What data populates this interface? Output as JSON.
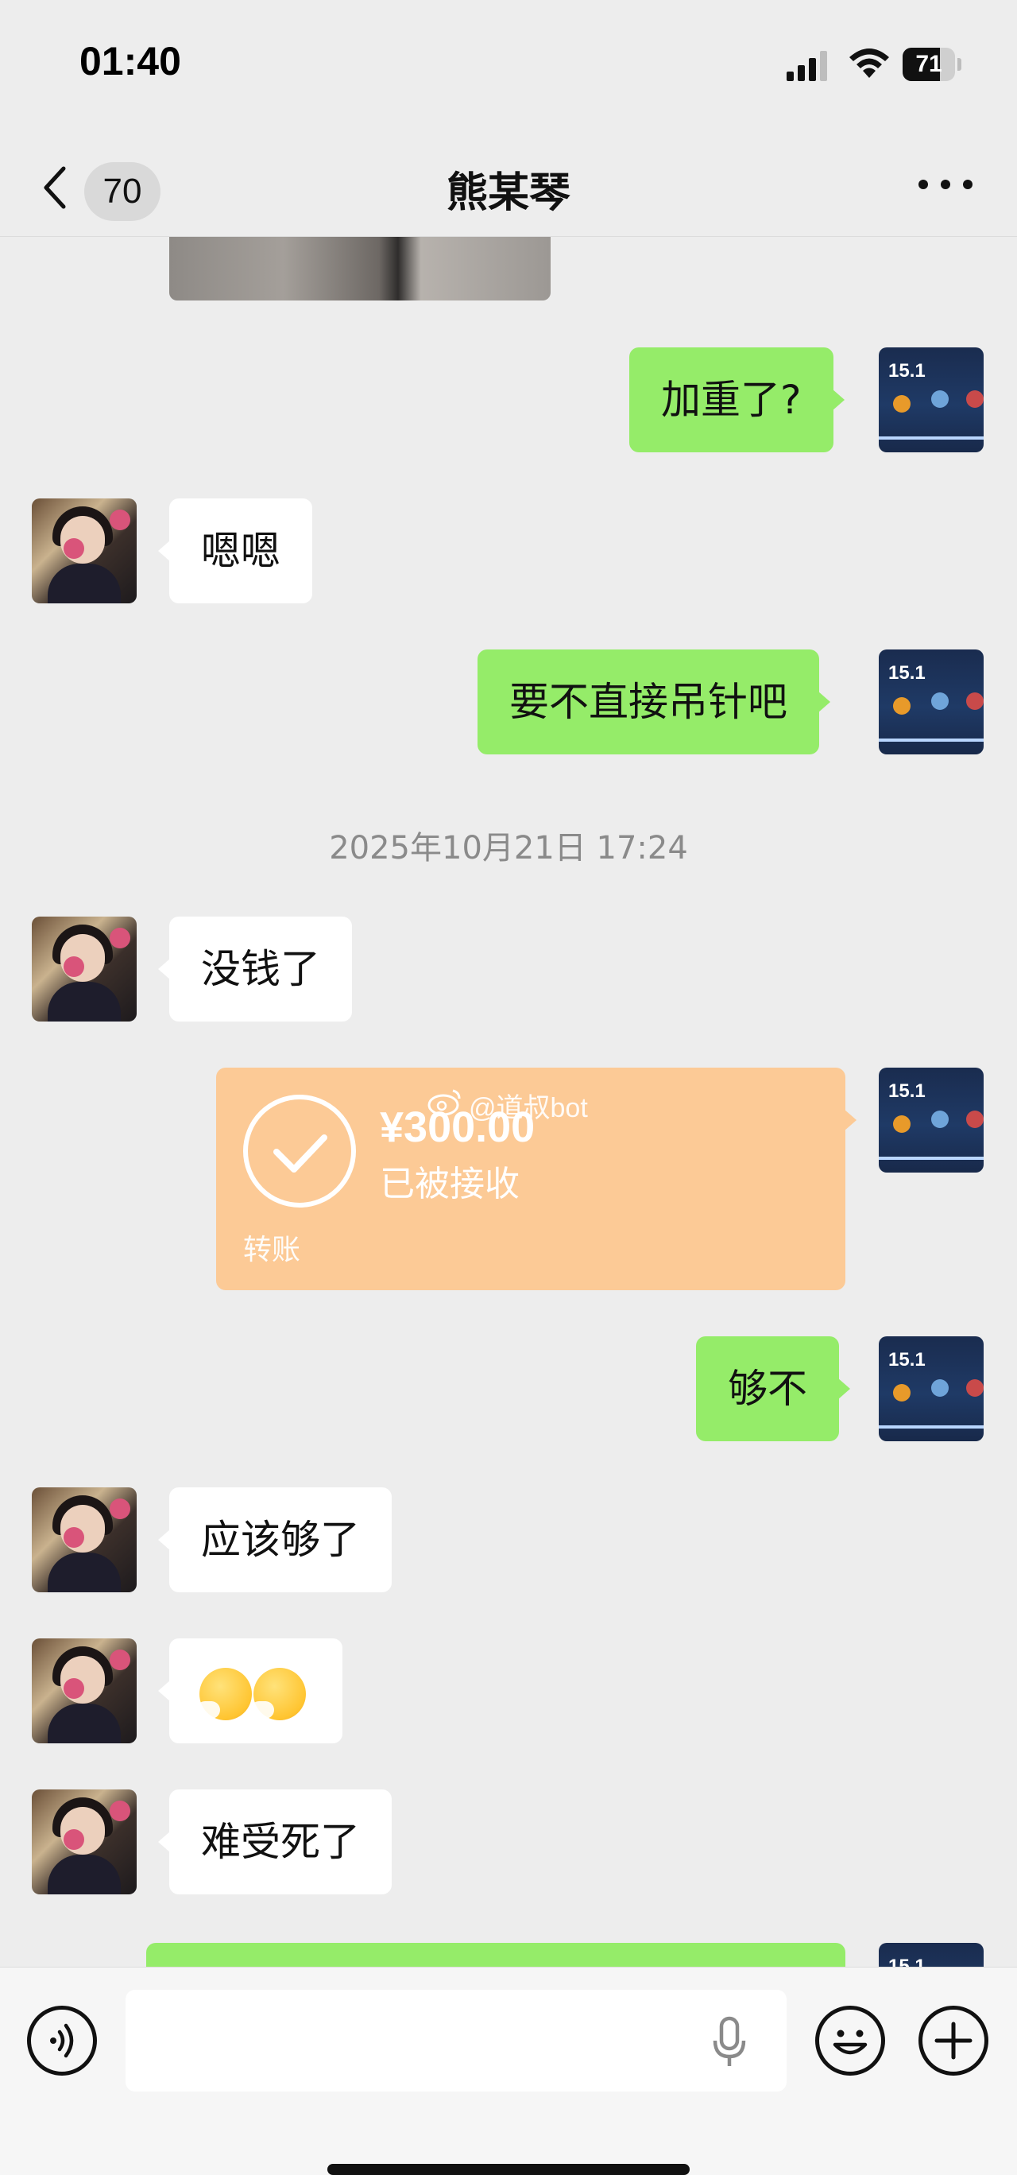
{
  "status_bar": {
    "time": "01:40",
    "battery": "71",
    "battery_level": 0.71
  },
  "nav": {
    "unread_count": "70",
    "title": "熊某琴"
  },
  "messages": {
    "m1": "加重了?",
    "m2": "嗯嗯",
    "m3": "要不直接吊针吧",
    "timestamp": "2025年10月21日 17:24",
    "m4": "没钱了",
    "transfer": {
      "amount": "¥300.00",
      "status": "已被接收",
      "label": "转账"
    },
    "m5": "够不",
    "m6": "应该够了",
    "m7_emoji": [
      "sneezing-face-icon",
      "sneezing-face-icon"
    ],
    "m8": "难受死了"
  },
  "avatars": {
    "self_badge": "15.1"
  },
  "watermark": "@道叔bot",
  "colors": {
    "outgoing_bubble": "#95ec69",
    "incoming_bubble": "#ffffff",
    "transfer_card": "#fcca96",
    "background": "#ededed"
  }
}
